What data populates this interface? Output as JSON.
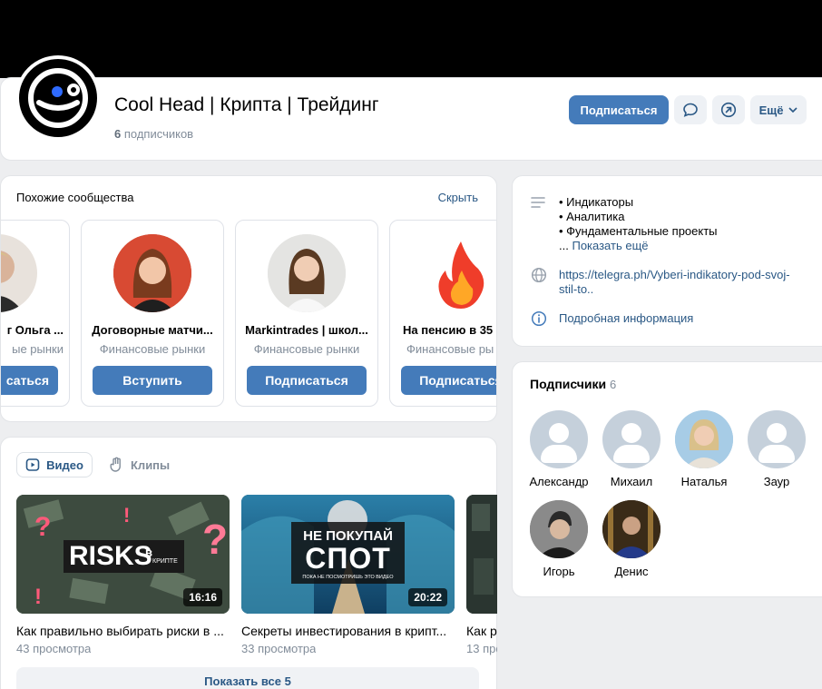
{
  "header": {
    "title": "Cool Head | Крипта | Трейдинг",
    "subscribers_count": "6",
    "subscribers_label": "подписчиков",
    "subscribe_button": "Подписаться",
    "more_button": "Ещё"
  },
  "similar": {
    "title": "Похожие сообщества",
    "hide_link": "Скрыть",
    "items": [
      {
        "name": "г Ольга ...",
        "category": "ые рынки",
        "button": "саться"
      },
      {
        "name": "Договорные матчи...",
        "category": "Финансовые рынки",
        "button": "Вступить"
      },
      {
        "name": "Markintrades | школ...",
        "category": "Финансовые рынки",
        "button": "Подписаться"
      },
      {
        "name": "На пенсию в 35 ...",
        "category": "Финансовые ры",
        "button": "Подписаться"
      }
    ]
  },
  "videos": {
    "tab_video": "Видео",
    "tab_clips": "Клипы",
    "items": [
      {
        "title": "Как правильно выбирать риски в ...",
        "views": "43 просмотра",
        "duration": "16:16",
        "thumb_text": "RISKS",
        "thumb_small": "в",
        "thumb_tiny": "КРИПТЕ"
      },
      {
        "title": "Секреты инвестирования в крипт...",
        "views": "33 просмотра",
        "duration": "20:22",
        "thumb_line1": "НЕ ПОКУПАЙ",
        "thumb_line2": "СПОТ",
        "thumb_line3": "ПОКА НЕ ПОСМОТРИШЬ ЭТО ВИДЕО"
      },
      {
        "title": "Как р",
        "views": "13 про"
      }
    ],
    "show_all": "Показать все 5"
  },
  "info": {
    "desc_lines": [
      "• Индикаторы",
      "• Аналитика",
      "• Фундаментальные проекты"
    ],
    "show_more_prefix": "...",
    "show_more": "Показать ещё",
    "link_line1": "https://telegra.ph/Vyberi-indikatory-pod-svoj-",
    "link_line2": "stil-to..",
    "details": "Подробная информация"
  },
  "followers": {
    "title": "Подписчики",
    "count": "6",
    "items": [
      {
        "name": "Александр"
      },
      {
        "name": "Михаил"
      },
      {
        "name": "Наталья"
      },
      {
        "name": "Заур"
      },
      {
        "name": "Игорь"
      },
      {
        "name": "Денис"
      }
    ]
  },
  "colors": {
    "accent": "#447bba",
    "link": "#2a5885",
    "muted": "#818c99",
    "background": "#edeef0"
  }
}
